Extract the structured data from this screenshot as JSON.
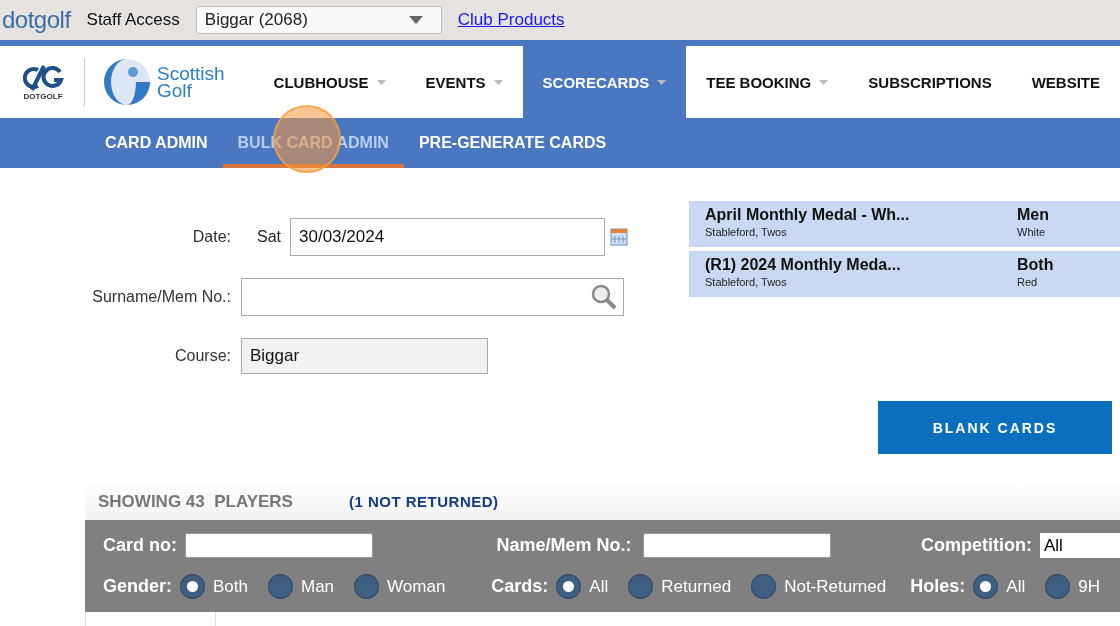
{
  "top_bar": {
    "logo": "dotgolf",
    "label": "Staff Access",
    "club_select": {
      "value": "Biggar (2068)"
    },
    "link": "Club Products"
  },
  "brand": {
    "dotgolf_caption": "DOTGOLF",
    "partner_name": "Scottish Golf"
  },
  "nav": [
    {
      "label": "CLUBHOUSE",
      "dropdown": true,
      "selected": false
    },
    {
      "label": "EVENTS",
      "dropdown": true,
      "selected": false
    },
    {
      "label": "SCORECARDS",
      "dropdown": true,
      "selected": true
    },
    {
      "label": "TEE BOOKING",
      "dropdown": true,
      "selected": false
    },
    {
      "label": "SUBSCRIPTIONS",
      "dropdown": false,
      "selected": false
    },
    {
      "label": "WEBSITE",
      "dropdown": false,
      "selected": false
    }
  ],
  "subnav": [
    {
      "label": "CARD ADMIN",
      "selected": false
    },
    {
      "label": "BULK CARD ADMIN",
      "selected": true
    },
    {
      "label": "PRE-GENERATE CARDS",
      "selected": false
    }
  ],
  "form": {
    "date": {
      "label": "Date:",
      "day": "Sat",
      "value": "30/03/2024"
    },
    "member": {
      "label": "Surname/Mem No.:"
    },
    "course": {
      "label": "Course:",
      "value": "Biggar"
    }
  },
  "competitions": [
    {
      "name": "April Monthly Medal - Wh...",
      "formats": "Stableford, Twos",
      "gender": "Men",
      "tee": "White"
    },
    {
      "name": "(R1) 2024 Monthly Meda...",
      "formats": "Stableford, Twos",
      "gender": "Both",
      "tee": "Red"
    }
  ],
  "blank_cards_button": "BLANK CARDS",
  "results": {
    "count": "SHOWING 43  PLAYERS",
    "not_returned": "(1 NOT RETURNED)",
    "card_no_label": "Card no:",
    "name_label": "Name/Mem No.:",
    "competition_label": "Competition:",
    "competition_value": "All",
    "radio_groups": [
      {
        "label": "Gender:",
        "options": [
          {
            "label": "Both",
            "selected": true
          },
          {
            "label": "Man",
            "selected": false
          },
          {
            "label": "Woman",
            "selected": false
          }
        ]
      },
      {
        "label": "Cards:",
        "options": [
          {
            "label": "All",
            "selected": true
          },
          {
            "label": "Returned",
            "selected": false
          },
          {
            "label": "Not-Returned",
            "selected": false
          }
        ]
      },
      {
        "label": "Holes:",
        "options": [
          {
            "label": "All",
            "selected": true
          },
          {
            "label": "9H",
            "selected": false
          }
        ]
      }
    ]
  }
}
